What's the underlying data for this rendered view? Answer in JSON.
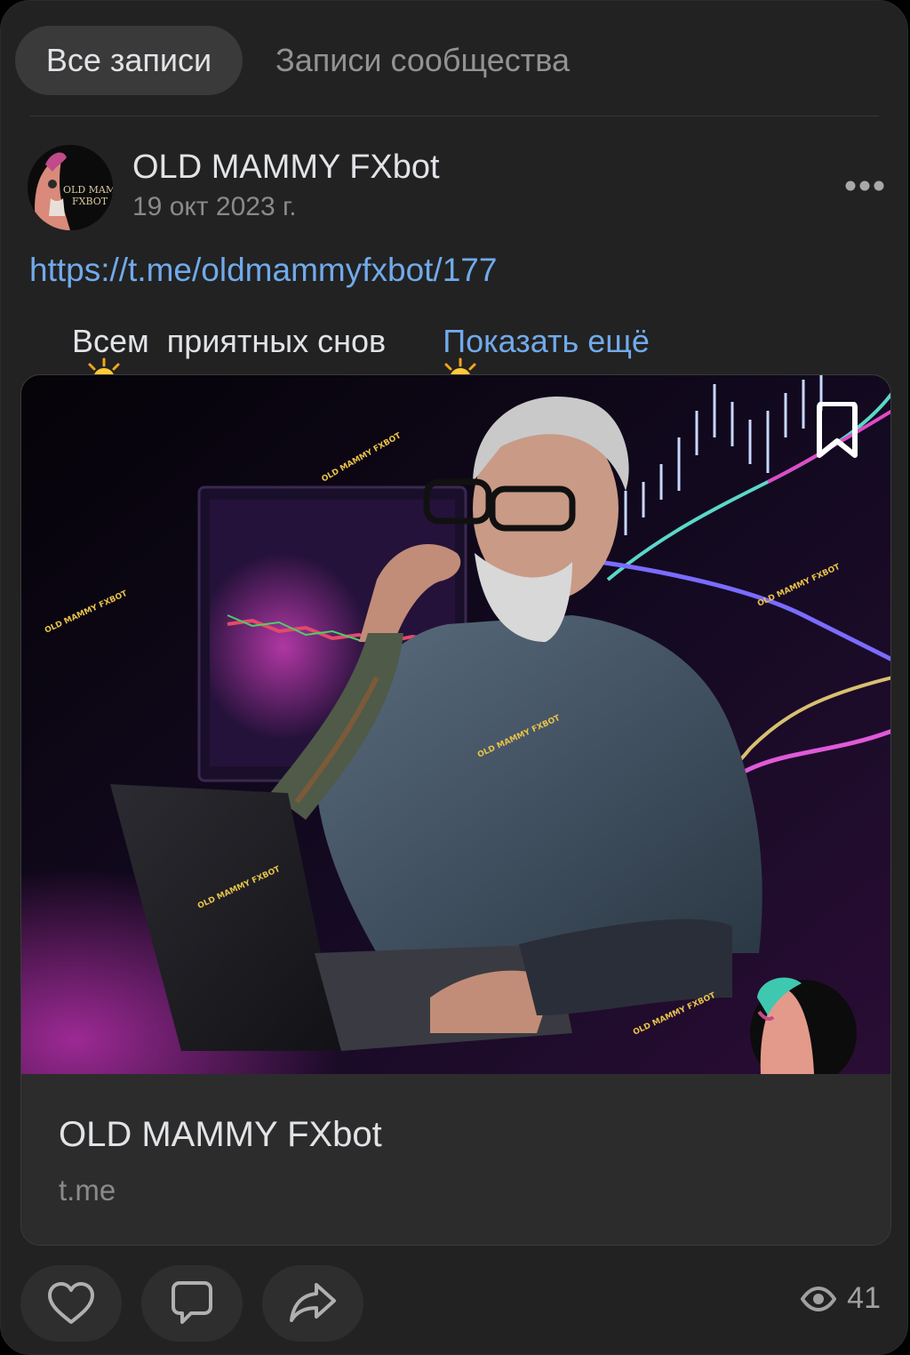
{
  "tabs": [
    {
      "label": "Все записи",
      "active": true
    },
    {
      "label": "Записи сообщества",
      "active": false
    }
  ],
  "post": {
    "author": "OLD MAMMY FXbot",
    "date": "19 окт 2023 г.",
    "avatar_text": [
      "OLD MAMI",
      "FXBOT"
    ],
    "link": "https://t.me/oldmammyfxbot/177",
    "text": "Всем  приятных снов",
    "show_more": "Показать ещё",
    "attachment": {
      "title": "OLD MAMMY FXbot",
      "domain": "t.me",
      "watermark": "OLD MAMMY FXBOT"
    },
    "views": "41"
  },
  "icons": {
    "more": "more-horizontal-icon",
    "bookmark": "bookmark-icon",
    "like": "heart-icon",
    "comment": "comment-icon",
    "share": "share-icon",
    "views": "eye-icon",
    "sun": "sun-emoji"
  },
  "colors": {
    "background": "#222222",
    "link": "#71aaeb",
    "text": "#e1e3e6",
    "secondary": "#8a8a8a"
  }
}
